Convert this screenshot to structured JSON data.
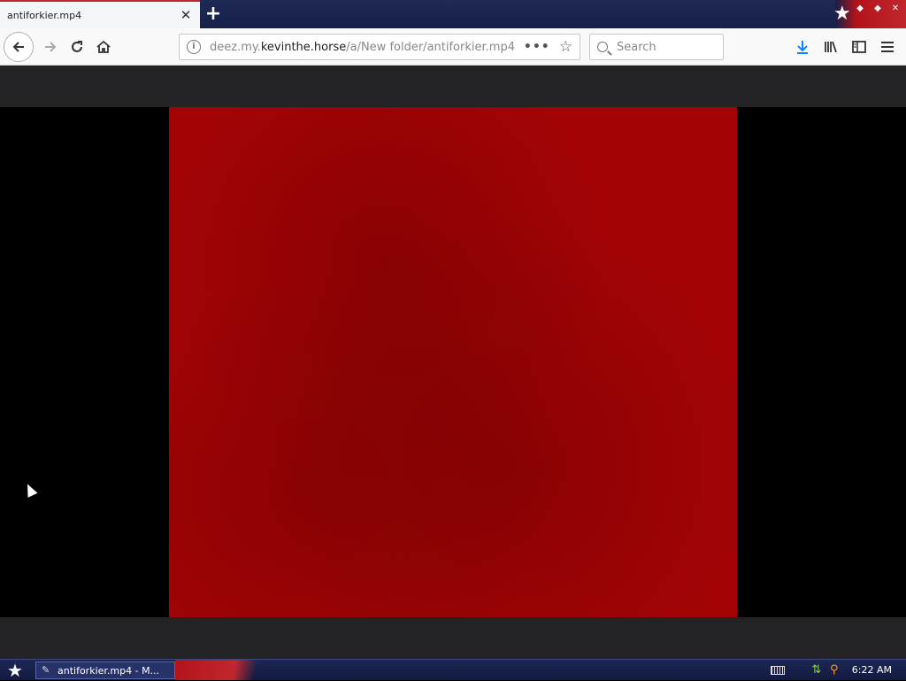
{
  "browser": {
    "tab": {
      "title": "antiforkier.mp4",
      "close": "✕"
    },
    "new_tab": "+",
    "url": {
      "prefix": "deez.my.",
      "host": "kevinthe.horse",
      "path": "/a/New folder/antiforkier.mp4"
    },
    "search": {
      "placeholder": "Search"
    },
    "icons": {
      "back": "back-arrow-icon",
      "forward": "forward-arrow-icon",
      "reload": "reload-icon",
      "home": "home-icon",
      "page_actions": "•••",
      "bookmark": "☆",
      "downloads": "download-icon",
      "library": "library-icon",
      "sidebar": "sidebar-icon",
      "menu": "hamburger-menu-icon"
    }
  },
  "video": {
    "frame_color": "#a30305",
    "bar_color": "#232325"
  },
  "taskbar": {
    "task_label": "antiforkier.mp4 - M...",
    "clock": "6:22 AM",
    "start_icon": "★"
  },
  "colors": {
    "accent_red": "#c1272d",
    "navy": "#1d2754"
  }
}
